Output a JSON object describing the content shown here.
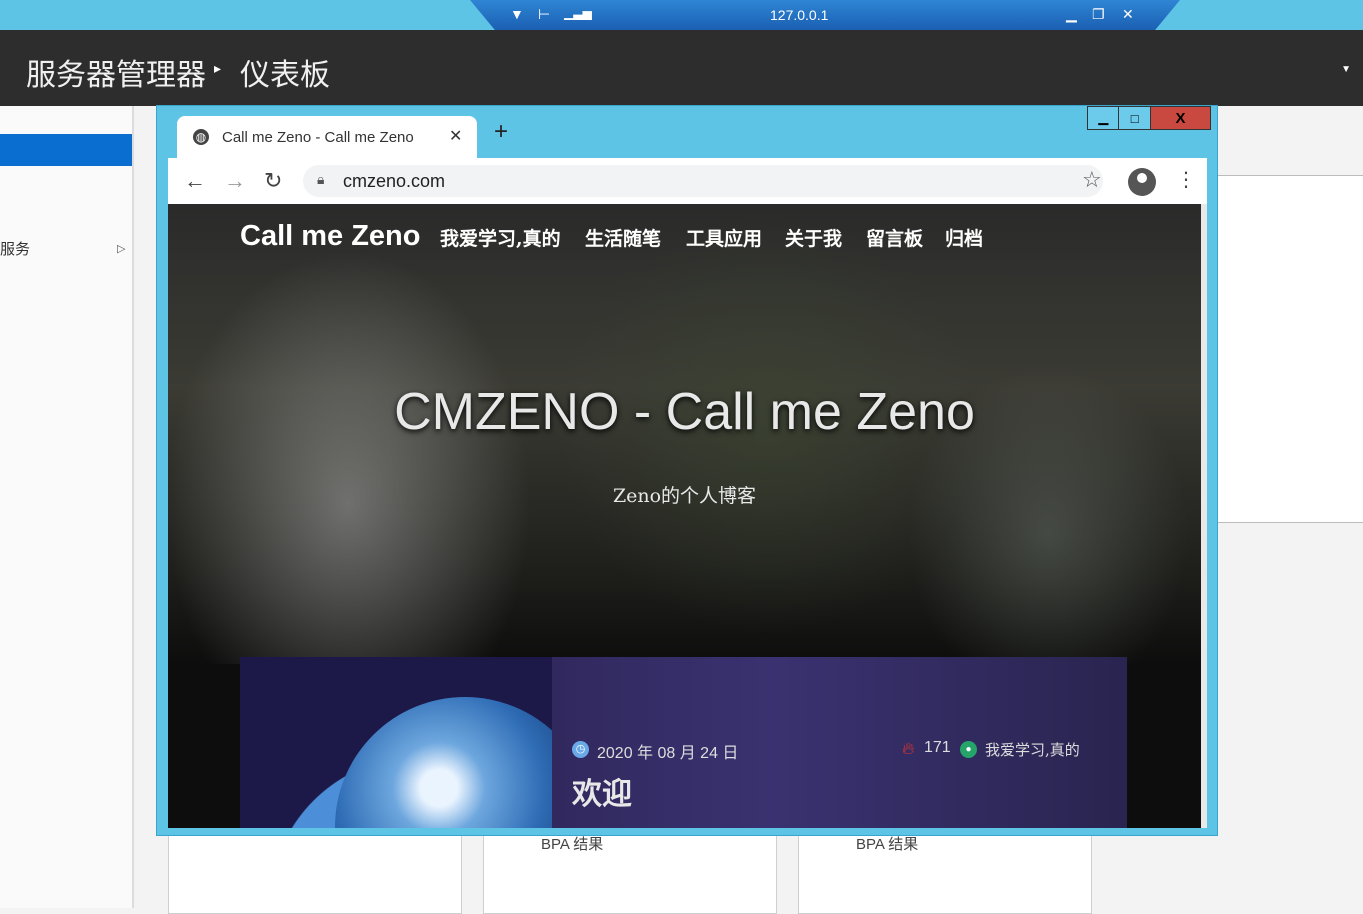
{
  "rdp_bar": {
    "title": "127.0.0.1"
  },
  "server_manager": {
    "title": "服务器管理器",
    "page": "仪表板",
    "sidebar": {
      "services_label": "服务"
    },
    "tiles": [
      {
        "label": "BPA 结果"
      },
      {
        "label": "BPA 结果"
      }
    ]
  },
  "browser": {
    "tab_title": "Call me Zeno - Call me Zeno",
    "url": "cmzeno.com"
  },
  "site": {
    "logo": "Call me Zeno",
    "nav": [
      "我爱学习,真的",
      "生活随笔",
      "工具应用",
      "关于我",
      "留言板",
      "归档"
    ],
    "hero_title": "CMZENO - Call me Zeno",
    "hero_subtitle": "Zeno的个人博客",
    "post": {
      "date": "2020 年 08 月 24 日",
      "views": "171",
      "category": "我爱学习,真的",
      "title": "欢迎"
    }
  },
  "colors": {
    "rdp_accent": "#5ec4e6",
    "sidebar_selected": "#0a6ed1",
    "header_dark": "#2d2d2d"
  }
}
